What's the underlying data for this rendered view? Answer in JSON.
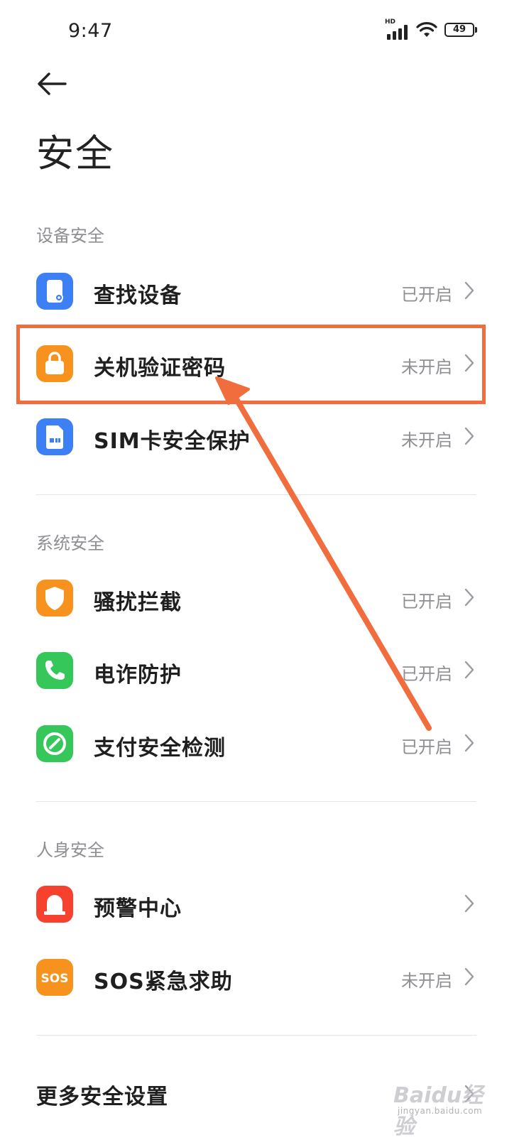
{
  "status_bar": {
    "time": "9:47",
    "network_label": "HD",
    "battery_level": "49"
  },
  "header": {
    "title": "安全"
  },
  "sections": [
    {
      "label": "设备安全",
      "items": [
        {
          "label": "查找设备",
          "state": "已开启",
          "icon": "find-device-icon",
          "icon_color": "#3d7ff5"
        },
        {
          "label": "关机验证密码",
          "state": "未开启",
          "icon": "lock-icon",
          "icon_color": "#f7921e"
        },
        {
          "label": "SIM卡安全保护",
          "state": "未开启",
          "icon": "sim-card-icon",
          "icon_color": "#3d7ff5"
        }
      ]
    },
    {
      "label": "系统安全",
      "items": [
        {
          "label": "骚扰拦截",
          "state": "已开启",
          "icon": "shield-icon",
          "icon_color": "#f7921e"
        },
        {
          "label": "电诈防护",
          "state": "已开启",
          "icon": "phone-icon",
          "icon_color": "#35c759"
        },
        {
          "label": "支付安全检测",
          "state": "已开启",
          "icon": "payment-check-icon",
          "icon_color": "#35c759"
        }
      ]
    },
    {
      "label": "人身安全",
      "items": [
        {
          "label": "预警中心",
          "state": "",
          "icon": "alarm-icon",
          "icon_color": "#f5412e"
        },
        {
          "label": "SOS紧急求助",
          "state": "未开启",
          "icon": "sos-icon",
          "icon_color": "#f7921e",
          "icon_text": "SOS"
        }
      ]
    }
  ],
  "more": {
    "label": "更多安全设置"
  },
  "annotation": {
    "color": "#f16d3d"
  },
  "watermark": {
    "logo": "Baidu经验",
    "sub": "jingyan.baidu.com"
  }
}
